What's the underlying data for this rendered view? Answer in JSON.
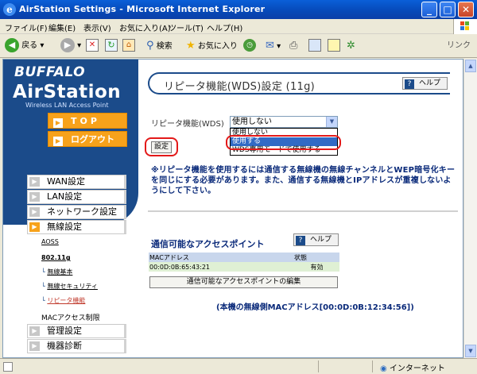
{
  "window": {
    "title": "AirStation Settings - Microsoft Internet Explorer",
    "buttons": {
      "minimize": "_",
      "maximize": "□",
      "close": "✕"
    }
  },
  "menu": [
    "ファイル(F)",
    "編集(E)",
    "表示(V)",
    "お気に入り(A)",
    "ツール(T)",
    "ヘルプ(H)"
  ],
  "toolbar": {
    "back": "戻る",
    "search": "検索",
    "favorites": "お気に入り",
    "links": "リンク"
  },
  "brand": {
    "logo": "BUFFALO",
    "product": "AirStation",
    "tagline": "Wireless LAN Access Point"
  },
  "nav": {
    "top": "TOP",
    "logout": "ログアウト"
  },
  "sidebar": {
    "items": [
      {
        "label": "WAN設定"
      },
      {
        "label": "LAN設定"
      },
      {
        "label": "ネットワーク設定"
      },
      {
        "label": "無線設定"
      }
    ],
    "sub": {
      "aoss": "AOSS",
      "std": "802.11g",
      "basic": "無線基本",
      "security": "無線セキュリティ",
      "repeater": "リピータ機能",
      "mac": "MACアクセス制限"
    },
    "items2": [
      {
        "label": "管理設定"
      },
      {
        "label": "機器診断"
      }
    ]
  },
  "page": {
    "title": "リピータ機能(WDS)設定 (11g)",
    "help": "ヘルプ",
    "field_label": "リピータ機能(WDS)",
    "select_value": "使用しない",
    "options": [
      "使用しない",
      "使用する",
      "WDS専用モードで使用する"
    ],
    "selected_option": "使用する",
    "apply": "設定",
    "note": "※リピータ機能を使用するには通信する無線機の無線チャンネルとWEP暗号化キーを同じにする必要があります。また、通信する無線機とIPアドレスが重複しないようにして下さい。"
  },
  "ap": {
    "heading": "通信可能なアクセスポイント",
    "help": "ヘルプ",
    "columns": [
      "MACアドレス",
      "状態"
    ],
    "rows": [
      {
        "mac": "00:0D:0B:65:43:21",
        "status": "有効"
      }
    ],
    "edit_button": "通信可能なアクセスポイントの編集"
  },
  "wlan_mac": "(本機の無線側MACアドレス[00:0D:0B:12:34:56])",
  "status": {
    "zone": "インターネット"
  },
  "colors": {
    "brand_blue": "#1b4b8a",
    "accent_orange": "#f7a21b",
    "highlight_red": "#e31919",
    "selection": "#316ac5"
  }
}
